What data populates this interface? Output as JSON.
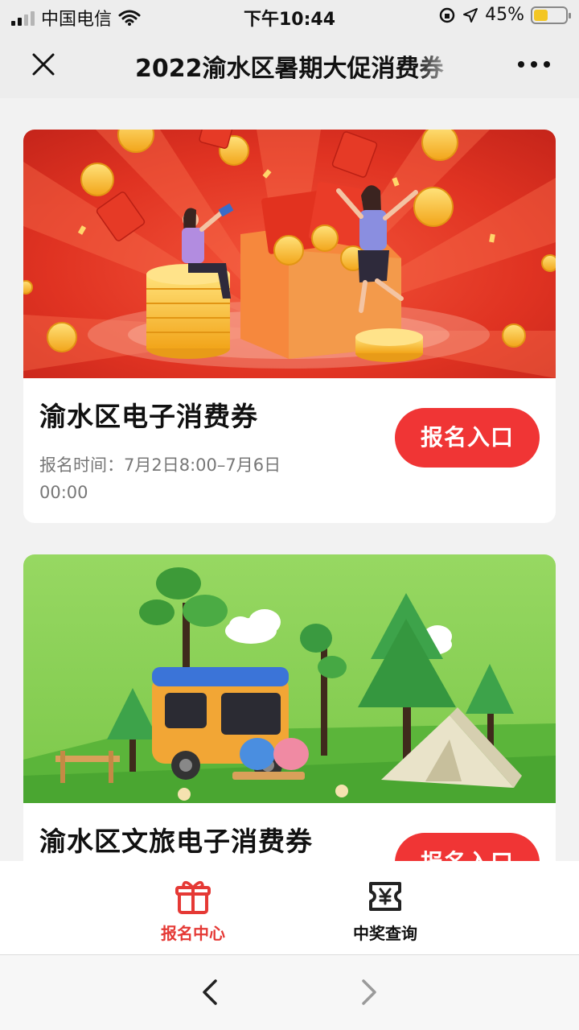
{
  "status_bar": {
    "carrier": "中国电信",
    "time": "下午10:44",
    "battery": "45%",
    "battery_level": 0.45,
    "icons": [
      "signal-icon",
      "wifi-icon",
      "orientation-lock-icon",
      "location-icon",
      "battery-charging-icon"
    ]
  },
  "navbar": {
    "title": "2022渝水区暑期大促消费券",
    "icons": [
      "close-icon",
      "more-icon"
    ]
  },
  "cards": [
    {
      "title": "渝水区电子消费券",
      "time": "报名时间：7月2日8:00–7月6日 00:00",
      "button": "报名入口"
    },
    {
      "title": "渝水区文旅电子消费券",
      "button": "报名入口"
    }
  ],
  "tabbar": {
    "tabs": [
      {
        "label": "报名中心",
        "icon": "gift-icon",
        "active": true
      },
      {
        "label": "中奖查询",
        "icon": "ticket-yen-icon",
        "active": false
      }
    ]
  },
  "bottom_nav": {
    "icons": [
      "back-arrow-icon",
      "forward-arrow-icon"
    ]
  },
  "colors": {
    "accent": "#f03535",
    "active_tab": "#e53935",
    "background": "#ededed",
    "text": "#111111",
    "muted_text": "#777777"
  }
}
